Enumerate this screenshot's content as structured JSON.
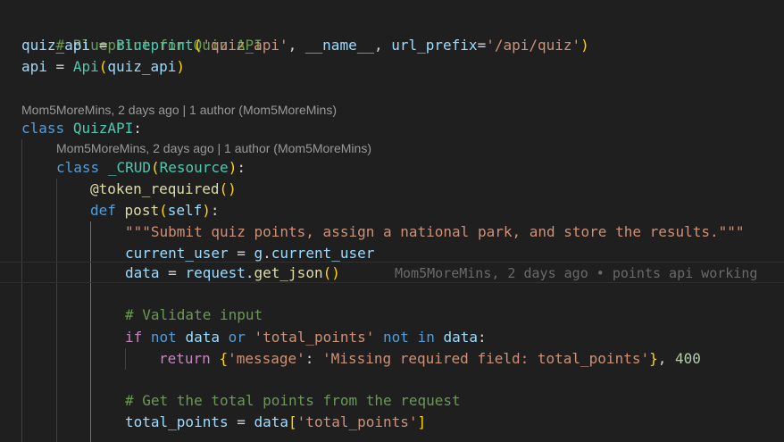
{
  "editor": {
    "language": "python",
    "theme_colors": {
      "background": "#1f1f1f",
      "comment": "#6a9955",
      "keyword": "#569cd6",
      "control": "#c586c0",
      "function": "#dcdcaa",
      "class": "#4ec9b0",
      "variable": "#9cdcfe",
      "string": "#ce9178",
      "number": "#b5cea8",
      "bracket_level1": "#ffd700",
      "bracket_level2": "#da70d6",
      "bracket_level3": "#179fff",
      "codelens": "#999999",
      "blame": "#6a6a6a"
    },
    "codelens": [
      "Mom5MoreMins, 2 days ago | 1 author (Mom5MoreMins)",
      "Mom5MoreMins, 2 days ago | 1 author (Mom5MoreMins)"
    ],
    "inline_blame": "Mom5MoreMins, 2 days ago • points api working",
    "code": {
      "l1": {
        "text": "# Blueprint for Quiz API"
      },
      "l2": {
        "var": "quiz_api",
        "eq": " = ",
        "fn": "Blueprint",
        "open": "(",
        "arg1": "'quiz_api'",
        "comma1": ", ",
        "arg2": "__name__",
        "comma2": ", ",
        "kwarg": "url_prefix",
        "eq2": "=",
        "arg3": "'/api/quiz'",
        "close": ")"
      },
      "l3": {
        "var": "api",
        "eq": " = ",
        "cls": "Api",
        "open": "(",
        "arg": "quiz_api",
        "close": ")"
      },
      "l4": {
        "kw": "class",
        "sp": " ",
        "name": "QuizAPI",
        "colon": ":"
      },
      "l5": {
        "kw": "class",
        "sp": " ",
        "name": "_CRUD",
        "open": "(",
        "base": "Resource",
        "close": ")",
        "colon": ":"
      },
      "l6": {
        "at": "@",
        "fn": "token_required",
        "open": "(",
        "close": ")"
      },
      "l7": {
        "kw": "def",
        "sp": " ",
        "fn": "post",
        "open": "(",
        "param": "self",
        "close": ")",
        "colon": ":"
      },
      "l8": {
        "doc": "\"\"\"Submit quiz points, assign a national park, and store the results.\"\"\""
      },
      "l9": {
        "var": "current_user",
        "eq": " = ",
        "obj": "g",
        "dot": ".",
        "attr": "current_user"
      },
      "l10": {
        "var": "data",
        "eq": " = ",
        "obj": "request",
        "dot": ".",
        "fn": "get_json",
        "open": "(",
        "close": ")"
      },
      "l11": {
        "text": "# Validate input"
      },
      "l12": {
        "if": "if",
        "sp1": " ",
        "not1": "not",
        "sp2": " ",
        "var1": "data",
        "sp3": " ",
        "or": "or",
        "sp4": " ",
        "str": "'total_points'",
        "sp5": " ",
        "not2": "not",
        "sp6": " ",
        "in": "in",
        "sp7": " ",
        "var2": "data",
        "colon": ":"
      },
      "l13": {
        "ret": "return",
        "sp": " ",
        "open": "{",
        "key": "'message'",
        "colon": ": ",
        "val": "'Missing required field: total_points'",
        "close": "}",
        "comma": ", ",
        "num": "400"
      },
      "l14": {
        "text": "# Get the total points from the request"
      },
      "l15": {
        "var": "total_points",
        "eq": " = ",
        "obj": "data",
        "open": "[",
        "key": "'total_points'",
        "close": "]"
      }
    }
  }
}
